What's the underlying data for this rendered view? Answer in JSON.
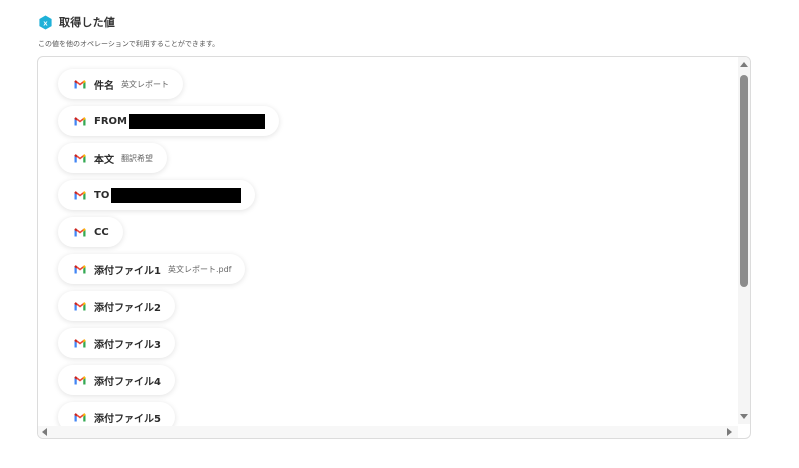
{
  "header": {
    "icon": "hexagon-x-icon",
    "icon_letter": "x",
    "title": "取得した値",
    "description": "この値を他のオペレーションで利用することができます。"
  },
  "colors": {
    "accent": "#1fb1d8",
    "redaction": "#000000"
  },
  "items": [
    {
      "icon": "gmail-icon",
      "label": "件名",
      "value": "英文レポート",
      "redacted": false
    },
    {
      "icon": "gmail-icon",
      "label": "FROM",
      "value": "",
      "redacted": true
    },
    {
      "icon": "gmail-icon",
      "label": "本文",
      "value": "翻訳希望",
      "redacted": false
    },
    {
      "icon": "gmail-icon",
      "label": "TO",
      "value": "",
      "redacted": true
    },
    {
      "icon": "gmail-icon",
      "label": "CC",
      "value": "",
      "redacted": false
    },
    {
      "icon": "gmail-icon",
      "label": "添付ファイル1",
      "value": "英文レポート.pdf",
      "redacted": false
    },
    {
      "icon": "gmail-icon",
      "label": "添付ファイル2",
      "value": "",
      "redacted": false
    },
    {
      "icon": "gmail-icon",
      "label": "添付ファイル3",
      "value": "",
      "redacted": false
    },
    {
      "icon": "gmail-icon",
      "label": "添付ファイル4",
      "value": "",
      "redacted": false
    },
    {
      "icon": "gmail-icon",
      "label": "添付ファイル5",
      "value": "",
      "redacted": false
    }
  ]
}
